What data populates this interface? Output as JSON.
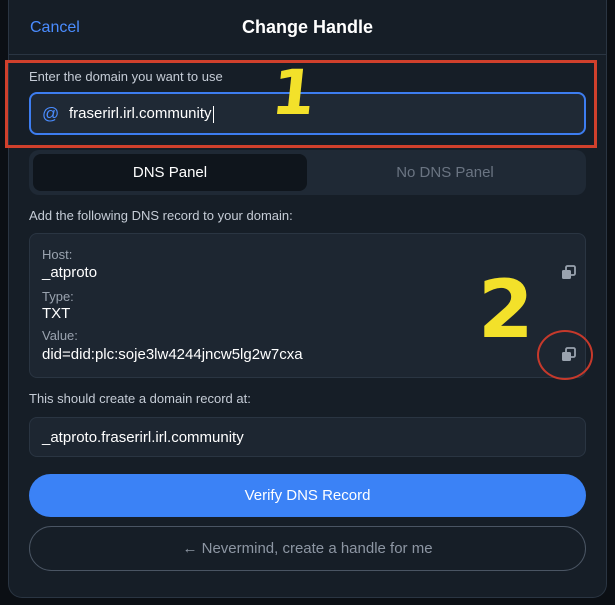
{
  "header": {
    "cancel_label": "Cancel",
    "title": "Change Handle"
  },
  "domain": {
    "label": "Enter the domain you want to use",
    "at_symbol": "@",
    "value": "fraserirl.irl.community"
  },
  "tabs": [
    {
      "label": "DNS Panel",
      "selected": true
    },
    {
      "label": "No DNS Panel",
      "selected": false
    }
  ],
  "instructions": "Add the following DNS record to your domain:",
  "record": {
    "host_label": "Host:",
    "host_value": "_atproto",
    "type_label": "Type:",
    "type_value": "TXT",
    "value_label": "Value:",
    "value_value": "did=did:plc:soje3lw4244jncw5lg2w7cxa"
  },
  "result": {
    "label": "This should create a domain record at:",
    "value": "_atproto.fraserirl.irl.community"
  },
  "buttons": {
    "verify": "Verify DNS Record",
    "nevermind": "← Nevermind, create a handle for me"
  },
  "annotations": {
    "mark_1": "1",
    "mark_2": "2"
  },
  "colors": {
    "accent": "#3b82f6",
    "annotation_red": "#d0402c",
    "annotation_yellow": "#f3e12a"
  },
  "icons": {
    "at": "at-sign",
    "copy": "copy-icon"
  }
}
